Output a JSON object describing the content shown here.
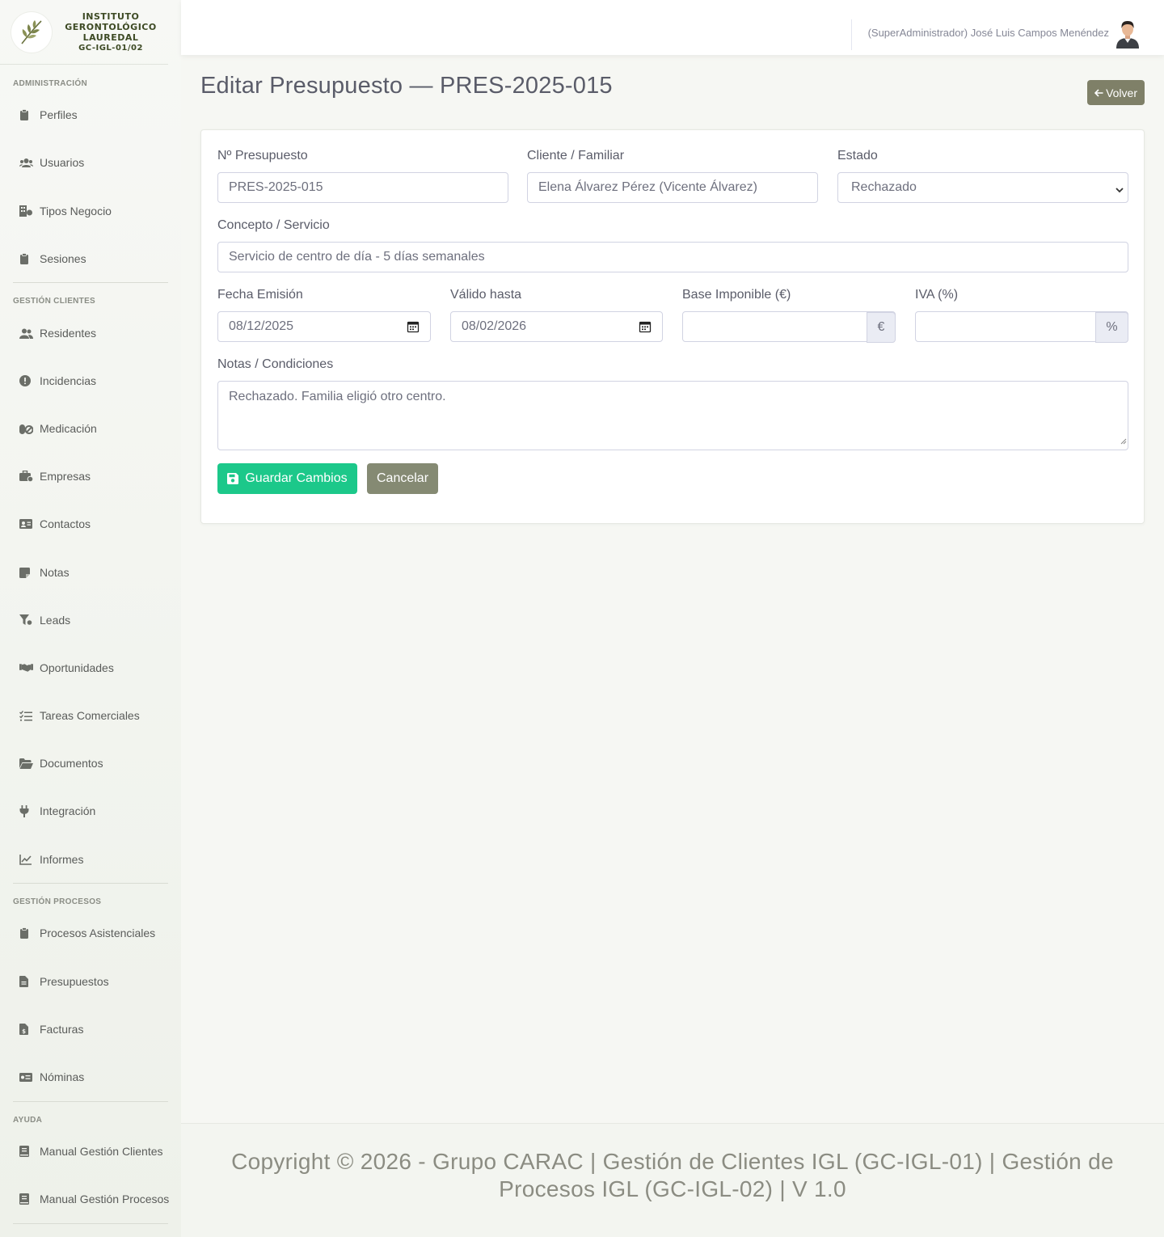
{
  "brand": {
    "line1": "INSTITUTO",
    "line2": "GERONTOLÓGICO",
    "line3": "LAUREDAL",
    "code": "GC-IGL-01/02"
  },
  "sidebar": {
    "sections": [
      {
        "title": "Administración"
      },
      {
        "title": "Gestión Clientes"
      },
      {
        "title": "Gestión Procesos"
      },
      {
        "title": "Ayuda"
      }
    ],
    "items": [
      {
        "label": "Perfiles",
        "icon": "clipboard-icon"
      },
      {
        "label": "Usuarios",
        "icon": "users-icon"
      },
      {
        "label": "Tipos Negocio",
        "icon": "building-icon"
      },
      {
        "label": "Sesiones",
        "icon": "clipboard-icon"
      },
      {
        "label": "Residentes",
        "icon": "user-group-icon"
      },
      {
        "label": "Incidencias",
        "icon": "alert-circle-icon"
      },
      {
        "label": "Medicación",
        "icon": "pills-icon"
      },
      {
        "label": "Empresas",
        "icon": "briefcase-icon"
      },
      {
        "label": "Contactos",
        "icon": "address-card-icon"
      },
      {
        "label": "Notas",
        "icon": "sticky-note-icon"
      },
      {
        "label": "Leads",
        "icon": "funnel-icon"
      },
      {
        "label": "Oportunidades",
        "icon": "handshake-icon"
      },
      {
        "label": "Tareas Comerciales",
        "icon": "task-list-icon"
      },
      {
        "label": "Documentos",
        "icon": "folder-open-icon"
      },
      {
        "label": "Integración",
        "icon": "plug-icon"
      },
      {
        "label": "Informes",
        "icon": "line-chart-icon"
      },
      {
        "label": "Procesos Asistenciales",
        "icon": "clipboard-icon"
      },
      {
        "label": "Presupuestos",
        "icon": "file-text-icon"
      },
      {
        "label": "Facturas",
        "icon": "invoice-icon"
      },
      {
        "label": "Nóminas",
        "icon": "money-bill-icon"
      },
      {
        "label": "Manual Gestión Clientes",
        "icon": "book-icon"
      },
      {
        "label": "Manual Gestión Procesos",
        "icon": "book-icon"
      }
    ]
  },
  "topbar": {
    "user": "(SuperAdministrador) José Luis Campos Menéndez"
  },
  "page": {
    "title": "Editar Presupuesto — PRES-2025-015",
    "back_label": "Volver"
  },
  "form": {
    "numero": {
      "label": "Nº Presupuesto",
      "value": "PRES-2025-015"
    },
    "cliente": {
      "label": "Cliente / Familiar",
      "value": "Elena Álvarez Pérez (Vicente Álvarez)"
    },
    "estado": {
      "label": "Estado",
      "value": "Rechazado"
    },
    "concepto": {
      "label": "Concepto / Servicio",
      "value": "Servicio de centro de día - 5 días semanales"
    },
    "fecha_emision": {
      "label": "Fecha Emisión",
      "value": "08/12/2025"
    },
    "valido_hasta": {
      "label": "Válido hasta",
      "value": "08/02/2026"
    },
    "base": {
      "label": "Base Imponible (€)",
      "value": "",
      "addon": "€"
    },
    "iva": {
      "label": "IVA (%)",
      "value": "",
      "addon": "%"
    },
    "notas": {
      "label": "Notas / Condiciones",
      "value": "Rechazado. Familia eligió otro centro."
    },
    "save_label": "Guardar Cambios",
    "cancel_label": "Cancelar"
  },
  "footer": {
    "text": "Copyright © 2026 - Grupo CARAC | Gestión de Clientes IGL (GC-IGL-01) | Gestión de Procesos IGL (GC-IGL-02) | V 1.0"
  },
  "colors": {
    "accent_green": "#1cc88a",
    "button_olive": "#858a73",
    "brand_text": "#3d4a24"
  }
}
